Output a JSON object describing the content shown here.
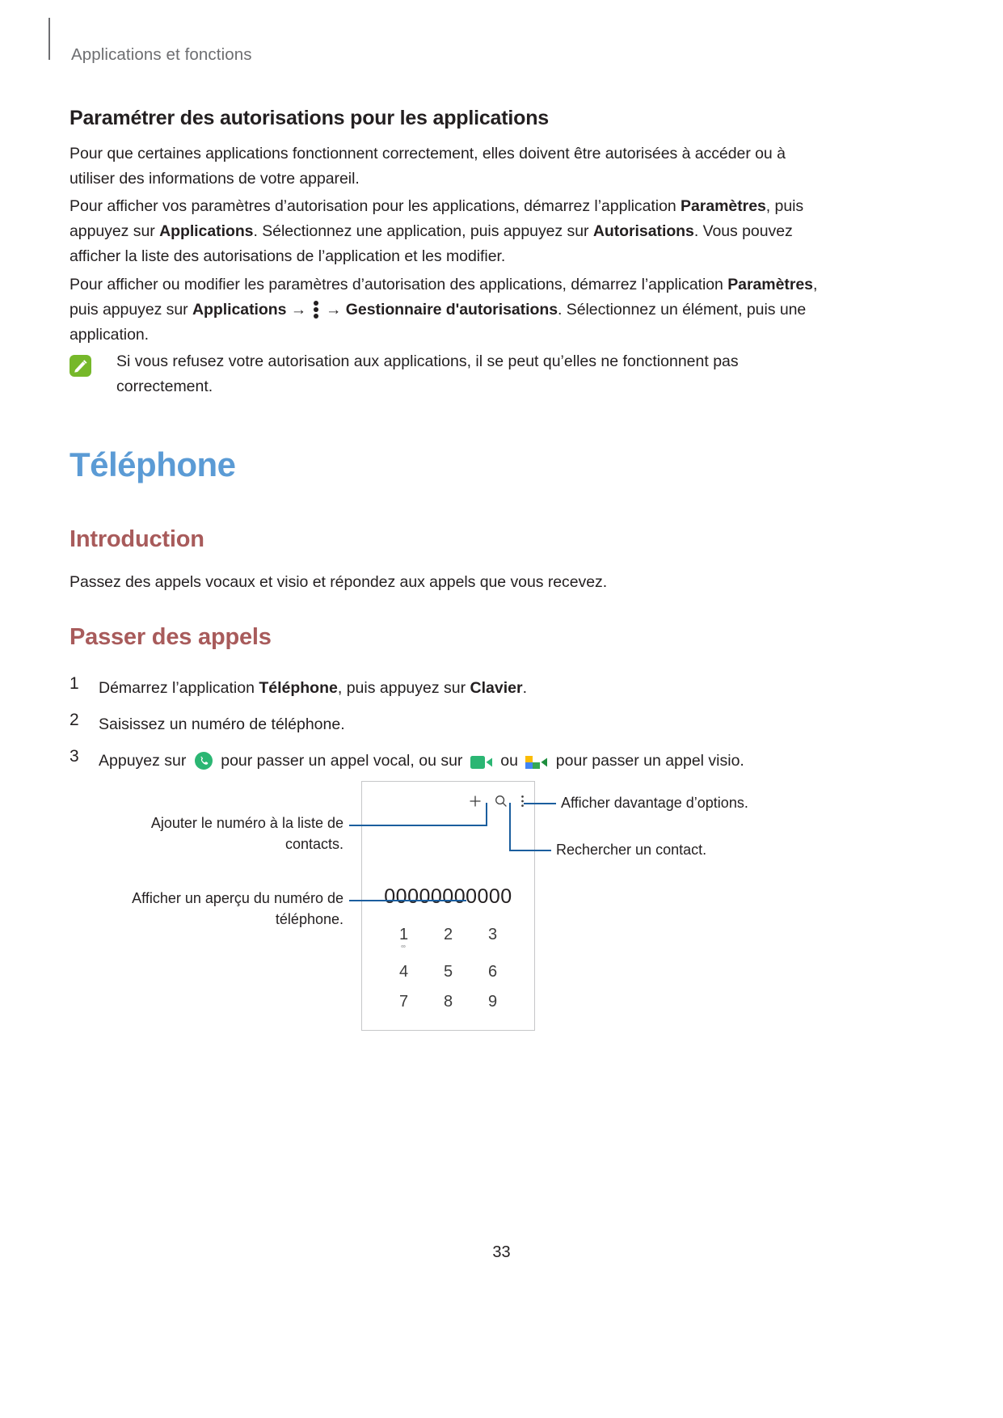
{
  "header": {
    "title": "Applications et fonctions"
  },
  "section": {
    "heading": "Paramétrer des autorisations pour les applications",
    "paragraph1": "Pour que certaines applications fonctionnent correctement, elles doivent être autorisées à accéder ou à utiliser des informations de votre appareil.",
    "paragraph2_part1": "Pour afficher vos paramètres d’autorisation pour les applications, démarrez l’application ",
    "paragraph2_bold1": "Paramètres",
    "paragraph2_part2": ", puis appuyez sur ",
    "paragraph2_bold2": "Applications",
    "paragraph2_part3": ". Sélectionnez une application, puis appuyez sur ",
    "paragraph2_bold3": "Autorisations",
    "paragraph2_part4": ". Vous pouvez afficher la liste des autorisations de l’application et les modifier.",
    "paragraph3_part1": "Pour afficher ou modifier les paramètres d’autorisation des applications, démarrez l’application ",
    "paragraph3_bold1": "Paramètres",
    "paragraph3_part2": ", puis appuyez sur ",
    "paragraph3_bold2": "Applications",
    "paragraph3_arrow1": " → ",
    "paragraph3_arrow2": " → ",
    "paragraph3_bold3": "Gestionnaire d'autorisations",
    "paragraph3_part3": ". Sélectionnez un élément, puis une application."
  },
  "note": {
    "icon": "note-icon",
    "text": "Si vous refusez votre autorisation aux applications, il se peut qu’elles ne fonctionnent pas correctement."
  },
  "chapter": {
    "title": "Téléphone",
    "intro_heading": "Introduction",
    "intro_text": "Passez des appels vocaux et visio et répondez aux appels que vous recevez.",
    "calls_heading": "Passer des appels"
  },
  "steps": [
    {
      "num": "1",
      "part1": "Démarrez l’application ",
      "bold1": "Téléphone",
      "part2": ", puis appuyez sur ",
      "bold2": "Clavier",
      "part3": "."
    },
    {
      "num": "2",
      "part1": "Saisissez un numéro de téléphone.",
      "bold1": "",
      "part2": "",
      "bold2": "",
      "part3": ""
    },
    {
      "num": "3",
      "part1": "Appuyez sur ",
      "mid1": " pour passer un appel vocal, ou sur ",
      "mid2": " ou ",
      "part3": " pour passer un appel visio.",
      "icon1": "phone-call-icon",
      "icon2": "video-call-icon",
      "icon3": "duo-video-call-icon"
    }
  ],
  "mockup": {
    "add_icon": "plus-icon",
    "search_icon": "search-icon",
    "more_icon": "more-options-icon",
    "number": "00000000000",
    "keypad": [
      [
        {
          "digit": "1",
          "sub": "∞"
        },
        {
          "digit": "2",
          "sub": ""
        },
        {
          "digit": "3",
          "sub": ""
        }
      ],
      [
        {
          "digit": "4",
          "sub": ""
        },
        {
          "digit": "5",
          "sub": ""
        },
        {
          "digit": "6",
          "sub": ""
        }
      ],
      [
        {
          "digit": "7",
          "sub": ""
        },
        {
          "digit": "8",
          "sub": ""
        },
        {
          "digit": "9",
          "sub": ""
        }
      ]
    ]
  },
  "callouts": {
    "add_contact": "Ajouter le numéro à la liste de contacts.",
    "preview_number": "Afficher un aperçu du numéro de téléphone.",
    "more_options": "Afficher davantage d’options.",
    "search_contact": "Rechercher un contact."
  },
  "footer": {
    "page_number": "33"
  },
  "colors": {
    "chapter_title": "#5b9bd5",
    "sub_heading": "#a85b5b",
    "leader_line": "#1b5e9e",
    "note_icon": "#76b82a",
    "header_text": "#6d6e71"
  }
}
